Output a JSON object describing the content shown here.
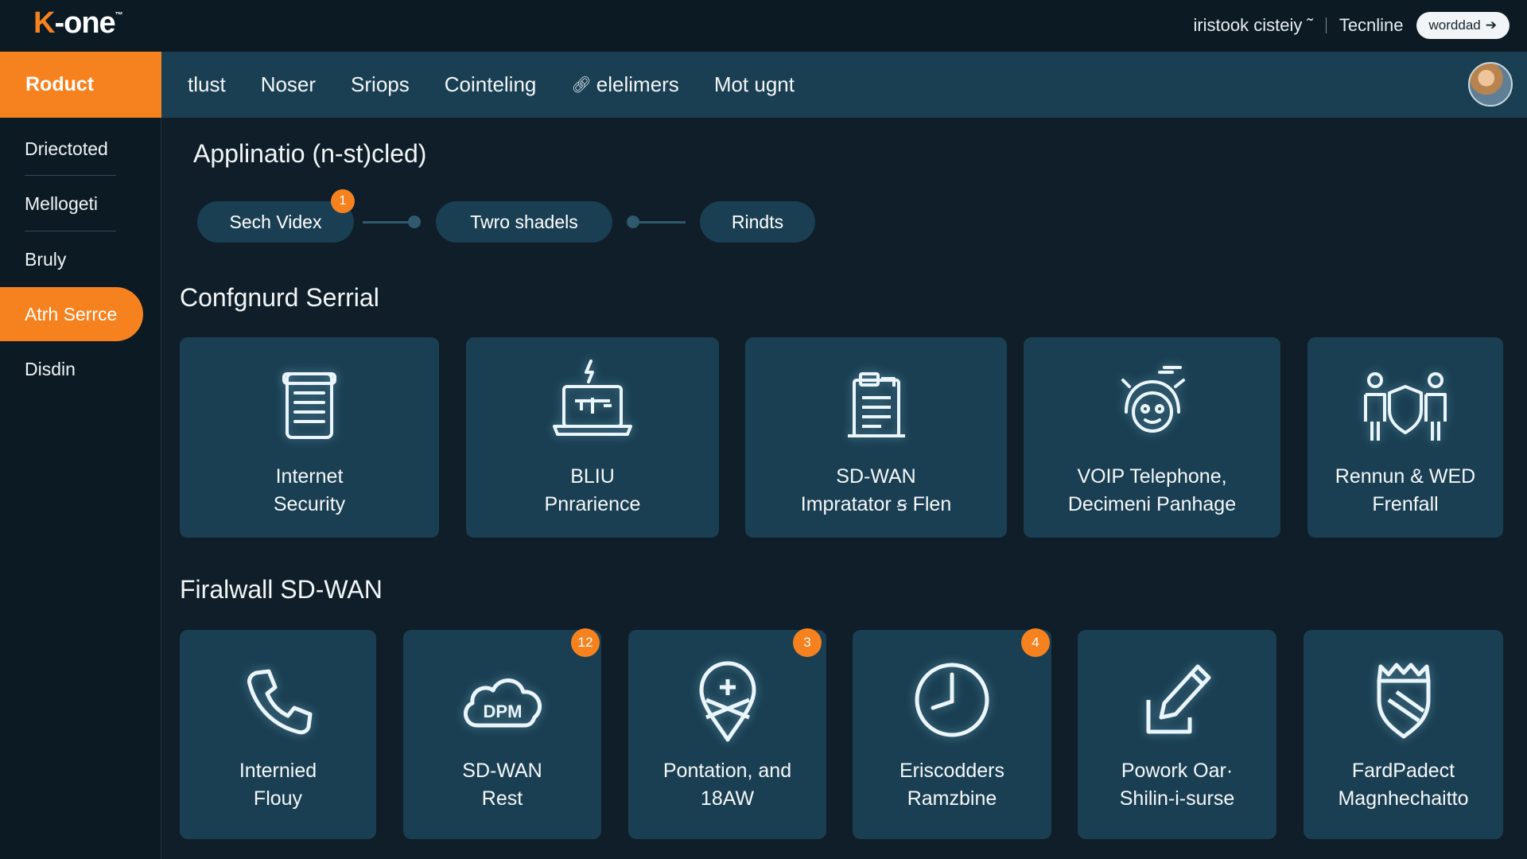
{
  "brand": {
    "logo_prefix": "K",
    "logo_suffix": "-one",
    "tm": "™",
    "accent": "#f5821f",
    "nav_bg": "#1a3f52",
    "bg": "#0f1e28"
  },
  "top": {
    "link": "iristook cisteiy ˜",
    "label": "Tecnline",
    "button": "worddad",
    "button_icon": "arrow-right-icon"
  },
  "nav": {
    "active": "Roduct",
    "items": [
      "tlust",
      "Noser",
      "Sriops",
      "Cointeling",
      "elelimers",
      "Mot ugnt"
    ],
    "item_icon": "link-icon"
  },
  "sidebar": {
    "items": [
      "Driectoted",
      "Mellogeti",
      "Bruly",
      "Atrh Serrce",
      "Disdin"
    ],
    "active_index": 3
  },
  "page": {
    "title": "Applinatio (n-st)cled)"
  },
  "steps": {
    "items": [
      "Sech Videx",
      "Twro shadels",
      "Rindts"
    ],
    "badge": "1"
  },
  "section1": {
    "title": "Confgnurd Serrial",
    "cards": [
      {
        "line1": "Internet",
        "line2": "Security",
        "icon": "document-icon"
      },
      {
        "line1": "BLIU",
        "line2": "Pnrarience",
        "icon": "laptop-icon"
      },
      {
        "line1": "SD-WAN",
        "line2": "Impratator ꞩ Flen",
        "icon": "clipboard-icon"
      },
      {
        "line1": "VOIP Telephone,",
        "line2": "Decimeni Panhage",
        "icon": "headset-icon"
      },
      {
        "line1": "Rennun & WED",
        "line2": "Frenfall",
        "icon": "shield-people-icon"
      }
    ]
  },
  "section2": {
    "title": "Firalwall SD-WAN",
    "cards": [
      {
        "line1": "Internied",
        "line2": "Flouy",
        "icon": "phone-icon",
        "badge": ""
      },
      {
        "line1": "SD-WAN",
        "line2": "Rest",
        "icon": "cloud-icon",
        "icon_text": "DPM",
        "badge": "12"
      },
      {
        "line1": "Pontation, and",
        "line2": "18AW",
        "icon": "location-pin-icon",
        "badge": "3"
      },
      {
        "line1": "Eriscodders",
        "line2": "Ramzbine",
        "icon": "clock-icon",
        "badge": "4"
      },
      {
        "line1": "Powork Oar·",
        "line2": "Shilin-i-surse",
        "icon": "edit-icon",
        "badge": ""
      },
      {
        "line1": "FardPadect",
        "line2": "Magnhechaitto",
        "icon": "shield-icon",
        "badge": ""
      }
    ]
  }
}
